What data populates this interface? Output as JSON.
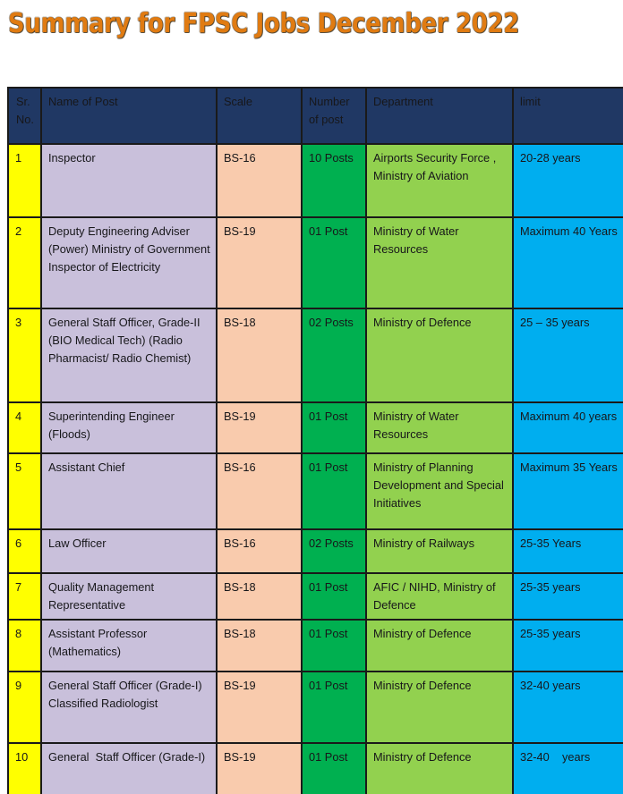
{
  "title": "Summary for FPSC Jobs December 2022",
  "colors": {
    "title_text": "#E07B12",
    "header_bg": "#203864",
    "header_text": "#FFFFFF",
    "sr_bg": "#FFFF00",
    "post_bg": "#C9C0DB",
    "scale_bg": "#F9CBAD",
    "number_bg": "#00B050",
    "department_bg": "#92D14F",
    "limit_bg": "#00AEEF",
    "border": "#1A1A1A"
  },
  "table": {
    "headers": {
      "sr": "Sr.\nNo.",
      "post": "Name of Post",
      "scale": "Scale",
      "number": "Number\nof post",
      "department": "Department",
      "limit": "limit"
    },
    "rows": [
      {
        "sr": "1",
        "post": "Inspector",
        "scale": "BS-16",
        "number": "10 Posts",
        "department": "Airports Security Force , Ministry of Aviation",
        "limit": "20-28 years"
      },
      {
        "sr": "2",
        "post": "Deputy Engineering Adviser (Power) Ministry of Government Inspector of Electricity",
        "scale": "BS-19",
        "number": "01 Post",
        "department": "Ministry of Water Resources",
        "limit": "Maximum 40 Years"
      },
      {
        "sr": "3",
        "post": "General Staff Officer, Grade-II (BIO Medical Tech) (Radio Pharmacist/ Radio Chemist)",
        "scale": "BS-18",
        "number": "02 Posts",
        "department": "Ministry of Defence",
        "limit": "25 – 35 years"
      },
      {
        "sr": "4",
        "post": "Superintending Engineer (Floods)",
        "scale": "BS-19",
        "number": "01 Post",
        "department": "Ministry of Water Resources",
        "limit": "Maximum 40 years"
      },
      {
        "sr": "5",
        "post": "Assistant Chief",
        "scale": "BS-16",
        "number": "01 Post",
        "department": "Ministry of Planning Development and Special Initiatives",
        "limit": "Maximum 35 Years"
      },
      {
        "sr": "6",
        "post": "Law Officer",
        "scale": "BS-16",
        "number": "02 Posts",
        "department": "Ministry of Railways",
        "limit": "25-35 Years"
      },
      {
        "sr": "7",
        "post": "Quality Management Representative",
        "scale": "BS-18",
        "number": "01 Post",
        "department": "AFIC / NIHD, Ministry of Defence",
        "limit": "25-35 years"
      },
      {
        "sr": "8",
        "post": "Assistant Professor (Mathematics)",
        "scale": "BS-18",
        "number": "01 Post",
        "department": "Ministry of Defence",
        "limit": "25-35 years"
      },
      {
        "sr": "9",
        "post": "General Staff Officer (Grade-I) Classified Radiologist",
        "scale": "BS-19",
        "number": "01 Post",
        "department": "Ministry of Defence",
        "limit": "32-40 years"
      },
      {
        "sr": "10",
        "post": "General  Staff Officer (Grade-I)",
        "scale": "BS-19",
        "number": "01 Post",
        "department": "Ministry of Defence",
        "limit": "32-40    years"
      }
    ]
  }
}
